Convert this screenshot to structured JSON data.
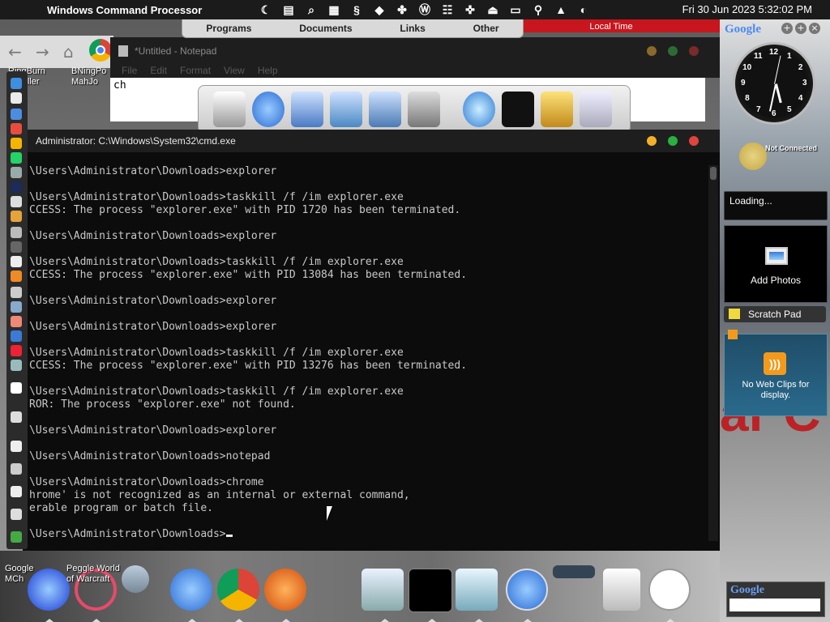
{
  "menubar": {
    "app_name": "Windows Command Processor",
    "clock": "Fri 30 Jun 2023  5:32:02 PM",
    "icons": [
      "moon-icon",
      "document-icon",
      "search-icon",
      "book-icon",
      "shazam-icon",
      "diamond-icon",
      "puzzle-icon",
      "w-icon",
      "server-icon",
      "gamepad-icon",
      "eject-icon",
      "window-icon",
      "magnifier-icon",
      "upload-icon",
      "toggle-icon"
    ]
  },
  "top_tabs": [
    "Programs",
    "Documents",
    "Links",
    "Other"
  ],
  "local_time": "Local Time",
  "desktop_labels": [
    {
      "text": "RingBurn\nInstaller"
    },
    {
      "text": "BNingPo\nMahJo"
    },
    {
      "text": "Google\nMCh"
    },
    {
      "text": "Peggle World\nof Warcraft"
    }
  ],
  "notepad": {
    "title": "*Untitled - Notepad",
    "menu": [
      "File",
      "Edit",
      "Format",
      "View",
      "Help"
    ],
    "content": "ch"
  },
  "cmd": {
    "title": "Administrator: C:\\Windows\\System32\\cmd.exe",
    "lines": [
      "\\Users\\Administrator\\Downloads>explorer",
      "",
      "\\Users\\Administrator\\Downloads>taskkill /f /im explorer.exe",
      "CCESS: The process \"explorer.exe\" with PID 1720 has been terminated.",
      "",
      "\\Users\\Administrator\\Downloads>explorer",
      "",
      "\\Users\\Administrator\\Downloads>taskkill /f /im explorer.exe",
      "CCESS: The process \"explorer.exe\" with PID 13084 has been terminated.",
      "",
      "\\Users\\Administrator\\Downloads>explorer",
      "",
      "\\Users\\Administrator\\Downloads>explorer",
      "",
      "\\Users\\Administrator\\Downloads>taskkill /f /im explorer.exe",
      "CCESS: The process \"explorer.exe\" with PID 13276 has been terminated.",
      "",
      "\\Users\\Administrator\\Downloads>taskkill /f /im explorer.exe",
      "ROR: The process \"explorer.exe\" not found.",
      "",
      "\\Users\\Administrator\\Downloads>explorer",
      "",
      "\\Users\\Administrator\\Downloads>notepad",
      "",
      "\\Users\\Administrator\\Downloads>chrome",
      "hrome' is not recognized as an internal or external command,",
      "erable program or batch file.",
      "",
      "\\Users\\Administrator\\Downloads>"
    ]
  },
  "gadgets": {
    "search_brand": "Google",
    "network_status": "Not Connected",
    "loading": "Loading...",
    "photos_label": "Add Photos",
    "scratch_pad": "Scratch Pad",
    "web_clips": "No Web Clips for\ndisplay.",
    "bottom_brand": "Google",
    "clock_numbers": [
      "12",
      "1",
      "2",
      "3",
      "4",
      "5",
      "6",
      "7",
      "8",
      "9",
      "10",
      "11"
    ],
    "clock_time": {
      "hour": 5,
      "minute": 32,
      "second": 2
    }
  },
  "colors": {
    "close": "#e0443e",
    "minimize": "#f2b02a",
    "maximize": "#2ab040",
    "accent_red": "#c7161d"
  }
}
